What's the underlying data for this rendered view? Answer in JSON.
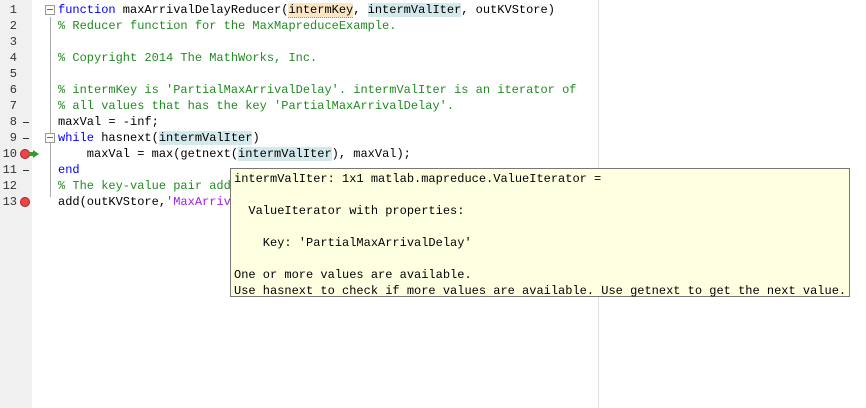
{
  "editor": {
    "lines": [
      {
        "n": "1",
        "parts": [
          [
            "kw",
            "function"
          ],
          [
            "",
            "  maxArrivalDelayReducer("
          ],
          [
            "hlo",
            "intermKey"
          ],
          [
            "",
            ", "
          ],
          [
            "hl",
            "intermValIter"
          ],
          [
            "",
            ", outKVStore)"
          ]
        ]
      },
      {
        "n": "2",
        "parts": [
          [
            "cm",
            "% Reducer function for the MaxMapreduceExample."
          ]
        ]
      },
      {
        "n": "3",
        "parts": []
      },
      {
        "n": "4",
        "parts": [
          [
            "cm",
            "% Copyright 2014 The MathWorks, Inc."
          ]
        ]
      },
      {
        "n": "5",
        "parts": []
      },
      {
        "n": "6",
        "parts": [
          [
            "cm",
            "% intermKey is 'PartialMaxArrivalDelay'. intermValIter is an iterator of"
          ]
        ]
      },
      {
        "n": "7",
        "parts": [
          [
            "cm",
            "% all values that has the key 'PartialMaxArrivalDelay'."
          ]
        ]
      },
      {
        "n": "8",
        "parts": [
          [
            "",
            "maxVal = -inf;"
          ]
        ]
      },
      {
        "n": "9",
        "parts": [
          [
            "kw",
            "while"
          ],
          [
            "",
            " hasnext("
          ],
          [
            "hl",
            "intermValIter"
          ],
          [
            "",
            ")"
          ]
        ]
      },
      {
        "n": "10",
        "parts": [
          [
            "",
            "    maxVal = max(getnext("
          ],
          [
            "hl",
            "intermValIter"
          ],
          [
            "",
            "), maxVal);"
          ]
        ]
      },
      {
        "n": "11",
        "parts": [
          [
            "kw",
            "end"
          ]
        ]
      },
      {
        "n": "12",
        "parts": [
          [
            "cm",
            "% The key-value pair add"
          ]
        ]
      },
      {
        "n": "13",
        "parts": [
          [
            "",
            "add(outKVStore,"
          ],
          [
            "str",
            "'MaxArriv"
          ]
        ]
      }
    ]
  },
  "tooltip": {
    "lines": [
      "intermValIter: 1x1 matlab.mapreduce.ValueIterator =",
      "",
      "  ValueIterator with properties:",
      "",
      "    Key: 'PartialMaxArrivalDelay'",
      "",
      "One or more values are available.",
      "Use hasnext to check if more values are available. Use getnext to get the next value."
    ]
  },
  "markers": {
    "dash_lines": [
      "8",
      "9",
      "11"
    ],
    "breakpoint_lines": [
      "10",
      "13"
    ],
    "current_line": "10"
  }
}
